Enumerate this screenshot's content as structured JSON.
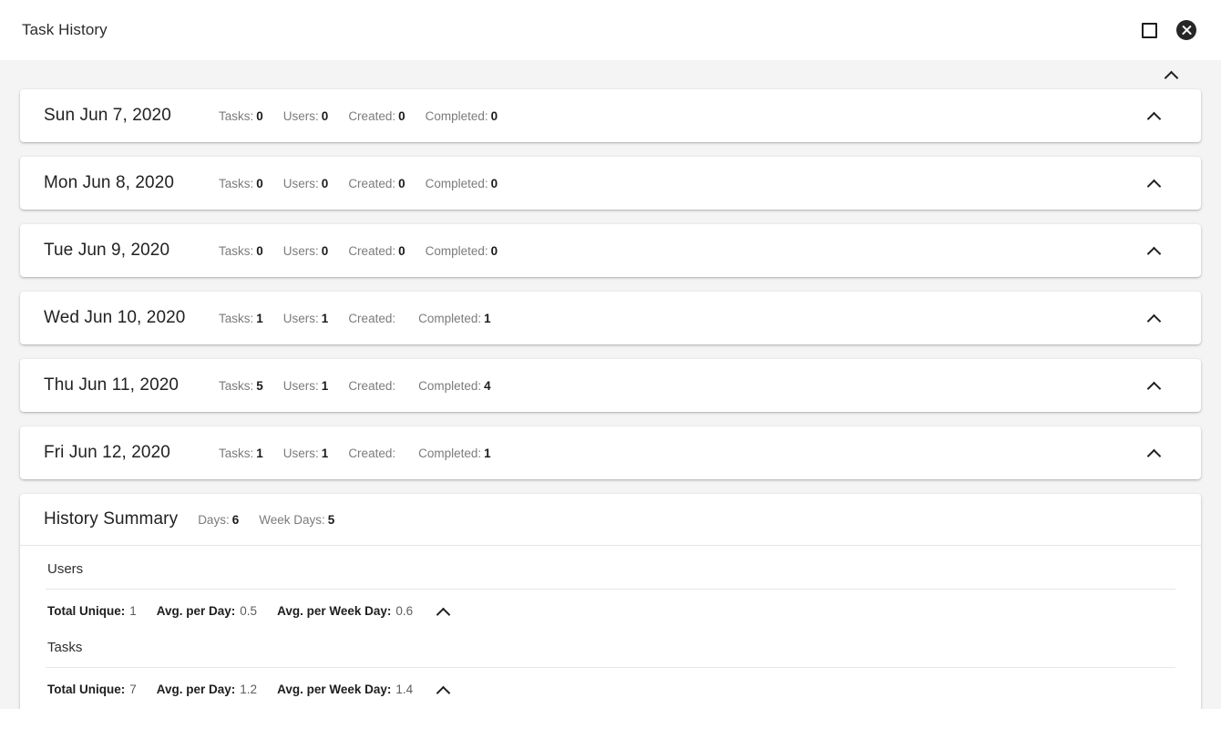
{
  "window": {
    "title": "Task History",
    "maximize_icon": "square-icon",
    "close_icon": "close-circle-icon"
  },
  "collapse_all": {
    "icon": "chevron-up-icon"
  },
  "days": [
    {
      "date": "Sun Jun 7, 2020",
      "stats": [
        {
          "label": "Tasks:",
          "value": "0"
        },
        {
          "label": "Users:",
          "value": "0"
        },
        {
          "label": "Created:",
          "value": "0"
        },
        {
          "label": "Completed:",
          "value": "0"
        }
      ],
      "toggle_icon": "chevron-up-icon"
    },
    {
      "date": "Mon Jun 8, 2020",
      "stats": [
        {
          "label": "Tasks:",
          "value": "0"
        },
        {
          "label": "Users:",
          "value": "0"
        },
        {
          "label": "Created:",
          "value": "0"
        },
        {
          "label": "Completed:",
          "value": "0"
        }
      ],
      "toggle_icon": "chevron-up-icon"
    },
    {
      "date": "Tue Jun 9, 2020",
      "stats": [
        {
          "label": "Tasks:",
          "value": "0"
        },
        {
          "label": "Users:",
          "value": "0"
        },
        {
          "label": "Created:",
          "value": "0"
        },
        {
          "label": "Completed:",
          "value": "0"
        }
      ],
      "toggle_icon": "chevron-up-icon"
    },
    {
      "date": "Wed Jun 10, 2020",
      "stats": [
        {
          "label": "Tasks:",
          "value": "1"
        },
        {
          "label": "Users:",
          "value": "1"
        },
        {
          "label": "Created:",
          "value": ""
        },
        {
          "label": "Completed:",
          "value": "1"
        }
      ],
      "toggle_icon": "chevron-up-icon"
    },
    {
      "date": "Thu Jun 11, 2020",
      "stats": [
        {
          "label": "Tasks:",
          "value": "5"
        },
        {
          "label": "Users:",
          "value": "1"
        },
        {
          "label": "Created:",
          "value": ""
        },
        {
          "label": "Completed:",
          "value": "4"
        }
      ],
      "toggle_icon": "chevron-up-icon"
    },
    {
      "date": "Fri Jun 12, 2020",
      "stats": [
        {
          "label": "Tasks:",
          "value": "1"
        },
        {
          "label": "Users:",
          "value": "1"
        },
        {
          "label": "Created:",
          "value": ""
        },
        {
          "label": "Completed:",
          "value": "1"
        }
      ],
      "toggle_icon": "chevron-up-icon"
    }
  ],
  "summary": {
    "title": "History Summary",
    "stats": [
      {
        "label": "Days:",
        "value": "6"
      },
      {
        "label": "Week Days:",
        "value": "5"
      }
    ],
    "groups": [
      {
        "label": "Users",
        "metrics": [
          {
            "label": "Total Unique:",
            "value": "1"
          },
          {
            "label": "Avg. per Day:",
            "value": "0.5"
          },
          {
            "label": "Avg. per Week Day:",
            "value": "0.6"
          }
        ],
        "toggle_icon": "chevron-up-icon"
      },
      {
        "label": "Tasks",
        "metrics": [
          {
            "label": "Total Unique:",
            "value": "7"
          },
          {
            "label": "Avg. per Day:",
            "value": "1.2"
          },
          {
            "label": "Avg. per Week Day:",
            "value": "1.4"
          }
        ],
        "toggle_icon": "chevron-up-icon"
      }
    ]
  },
  "colors": {
    "background": "#f4f4f4",
    "card": "#ffffff",
    "text_primary": "#222222",
    "text_muted": "#7b7b7b",
    "divider": "#e6e6e6"
  }
}
